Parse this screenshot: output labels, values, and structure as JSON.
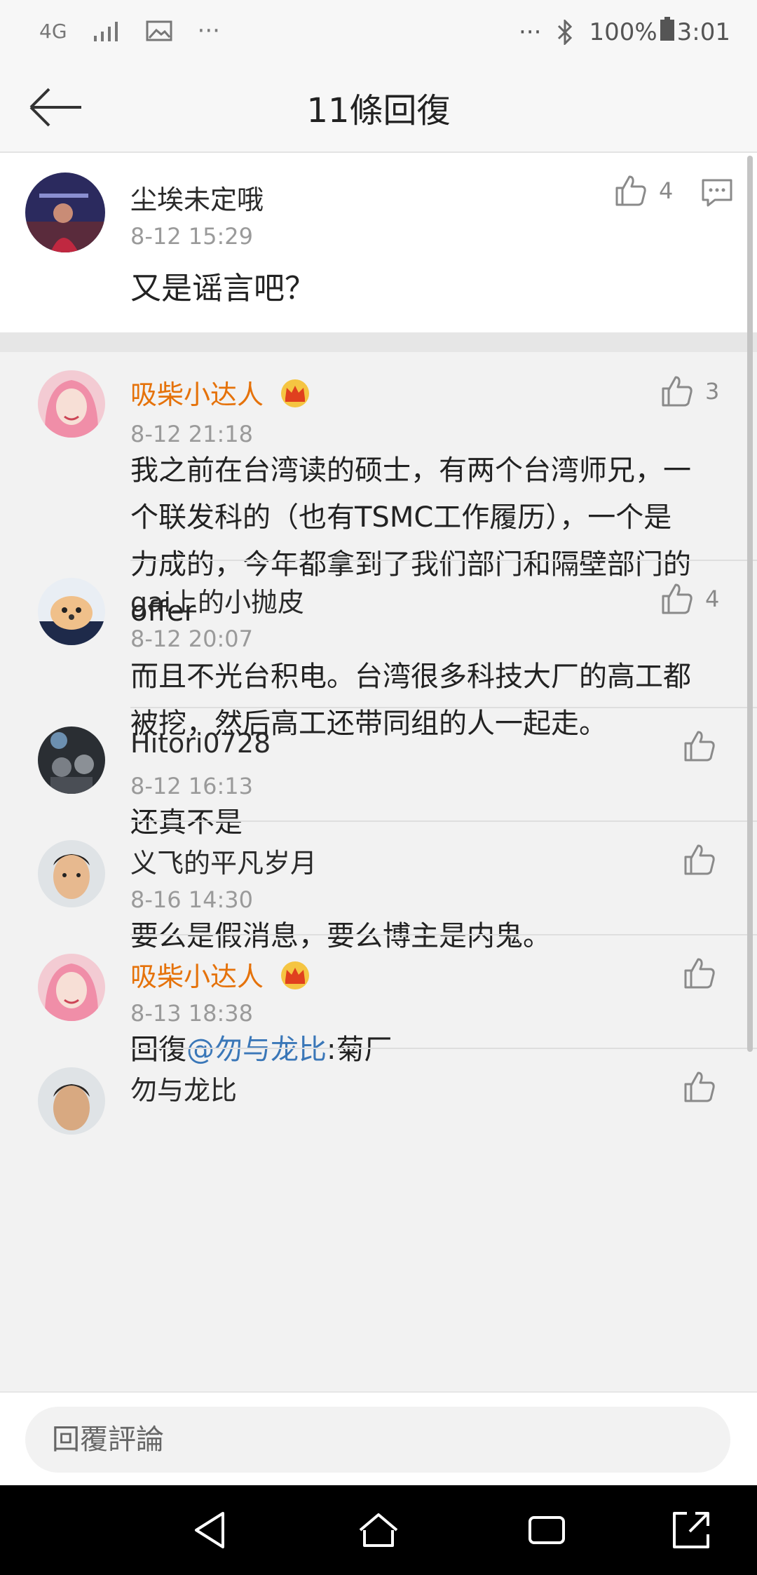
{
  "status_bar": {
    "network": "4G",
    "more": "···",
    "battery": "100%",
    "time": "3:01"
  },
  "header": {
    "title": "11條回復"
  },
  "root_comment": {
    "name": "尘埃未定哦",
    "time": "8-12 15:29",
    "likes": "4",
    "content": "又是谣言吧？"
  },
  "replies": [
    {
      "name": "吸柴小达人",
      "vip": true,
      "time": "8-12 21:18",
      "likes": "3",
      "lines": [
        "我之前在台湾读的硕士，有两个台湾师兄，一",
        "个联发科的（也有TSMC工作履历），一个是",
        "力成的，今年都拿到了我们部门和隔壁部门的",
        "offer"
      ]
    },
    {
      "name": "gai上的小抛皮",
      "vip": false,
      "time": "8-12 20:07",
      "likes": "4",
      "lines": [
        "而且不光台积电。台湾很多科技大厂的高工都",
        "被挖，然后高工还带同组的人一起走。"
      ]
    },
    {
      "name": "Hitori0728",
      "vip": false,
      "time": "8-12 16:13",
      "likes": "",
      "lines": [
        "还真不是"
      ]
    },
    {
      "name": "义飞的平凡岁月",
      "vip": false,
      "time": "8-16 14:30",
      "likes": "",
      "lines": [
        "要么是假消息，要么博主是内鬼。"
      ]
    },
    {
      "name": "吸柴小达人",
      "vip": true,
      "time": "8-13 18:38",
      "likes": "",
      "reply_prefix": "回復",
      "mention": "@勿与龙比",
      "suffix": ":菊厂"
    },
    {
      "name": "勿与龙比",
      "vip": false
    }
  ],
  "reply_bar": {
    "placeholder": "回覆評論"
  },
  "colors": {
    "vip_name": "#e5720a",
    "mention": "#3a77b8"
  }
}
